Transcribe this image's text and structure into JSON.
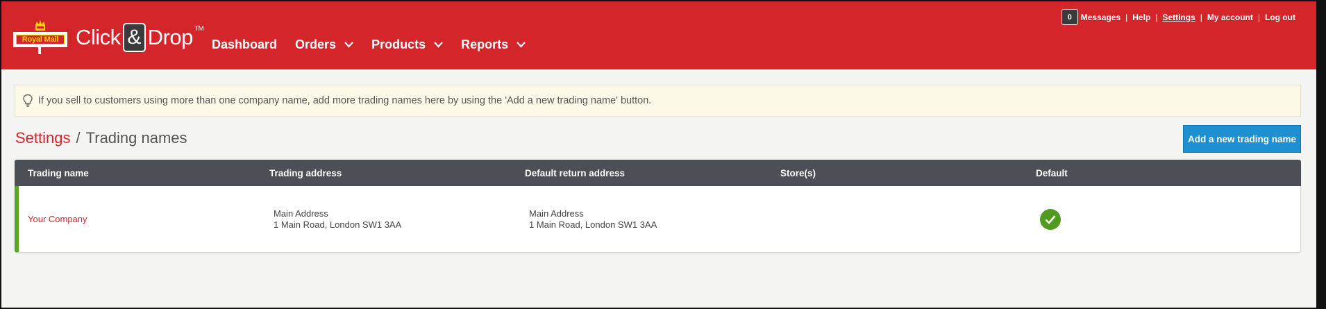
{
  "header": {
    "logo_text": "Royal Mail",
    "brand": {
      "part1": "Click",
      "amp": "&",
      "part2": "Drop",
      "tm": "TM"
    },
    "nav": [
      {
        "label": "Dashboard",
        "dropdown": false
      },
      {
        "label": "Orders",
        "dropdown": true
      },
      {
        "label": "Products",
        "dropdown": true
      },
      {
        "label": "Reports",
        "dropdown": true
      }
    ],
    "topbar": {
      "message_count": "0",
      "messages": "Messages",
      "help": "Help",
      "settings": "Settings",
      "my_account": "My account",
      "log_out": "Log out",
      "separator": "|"
    }
  },
  "info": {
    "text": "If you sell to customers using more than one company name, add more trading names here by using the 'Add a new trading name' button."
  },
  "page": {
    "breadcrumb": "Settings",
    "slash": "/",
    "title": "Trading names",
    "add_button": "Add a new trading name"
  },
  "table": {
    "headers": [
      "Trading name",
      "Trading address",
      "Default return address",
      "Store(s)",
      "Default"
    ],
    "rows": [
      {
        "trading_name": "Your Company",
        "trading_address": {
          "line1": "Main Address",
          "line2": "1 Main Road, London SW1 3AA"
        },
        "return_address": {
          "line1": "Main Address",
          "line2": "1 Main Road, London SW1 3AA"
        },
        "stores": "",
        "default": true
      }
    ]
  },
  "colors": {
    "header_red": "#d4252b",
    "button_blue": "#1e8fd0",
    "table_header": "#4d4f56",
    "check_green": "#4f9a1f",
    "row_accent": "#5aa522"
  }
}
